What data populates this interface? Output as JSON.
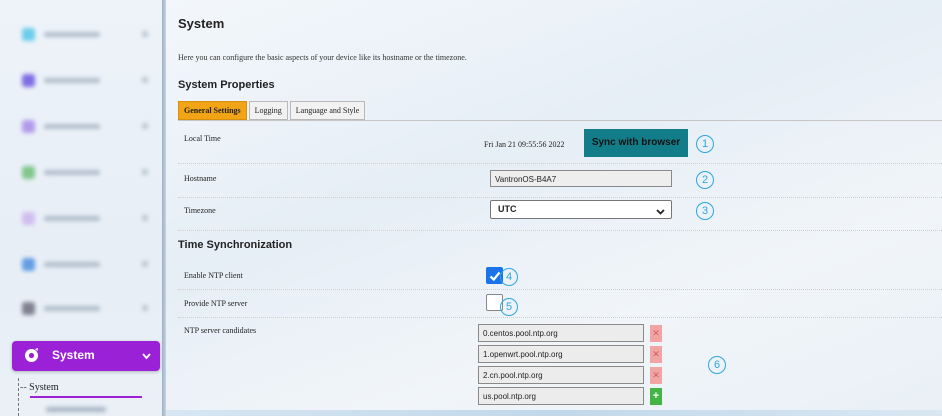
{
  "sidebar": {
    "active_menu_label": "System",
    "active_submenu_label": "System",
    "tree_prefix": "--",
    "brand_color": "#9b21d6"
  },
  "page": {
    "title": "System",
    "description": "Here you can configure the basic aspects of your device like its hostname or the timezone."
  },
  "system_properties": {
    "title": "System Properties",
    "tabs": [
      {
        "label": "General Settings",
        "active": true
      },
      {
        "label": "Logging",
        "active": false
      },
      {
        "label": "Language and Style",
        "active": false
      }
    ],
    "local_time": {
      "label": "Local Time",
      "value": "Fri Jan 21 09:55:56 2022",
      "sync_button": "Sync with browser"
    },
    "hostname": {
      "label": "Hostname",
      "value": "VantronOS-B4A7"
    },
    "timezone": {
      "label": "Timezone",
      "value": "UTC"
    }
  },
  "time_sync": {
    "title": "Time Synchronization",
    "enable_ntp": {
      "label": "Enable NTP client",
      "checked": true
    },
    "provide_ntp": {
      "label": "Provide NTP server",
      "checked": false
    },
    "candidates": {
      "label": "NTP server candidates",
      "servers": [
        "0.centos.pool.ntp.org",
        "1.openwrt.pool.ntp.org",
        "2.cn.pool.ntp.org",
        "us.pool.ntp.org"
      ]
    }
  },
  "callouts": [
    "1",
    "2",
    "3",
    "4",
    "5",
    "6"
  ],
  "colors": {
    "active_tab": "#f2a417",
    "sync_button": "#127d89",
    "callout": "#2ba7de",
    "checkbox_checked": "#1a73e8",
    "remove_button": "#f1a4a4",
    "add_button": "#44b544"
  }
}
